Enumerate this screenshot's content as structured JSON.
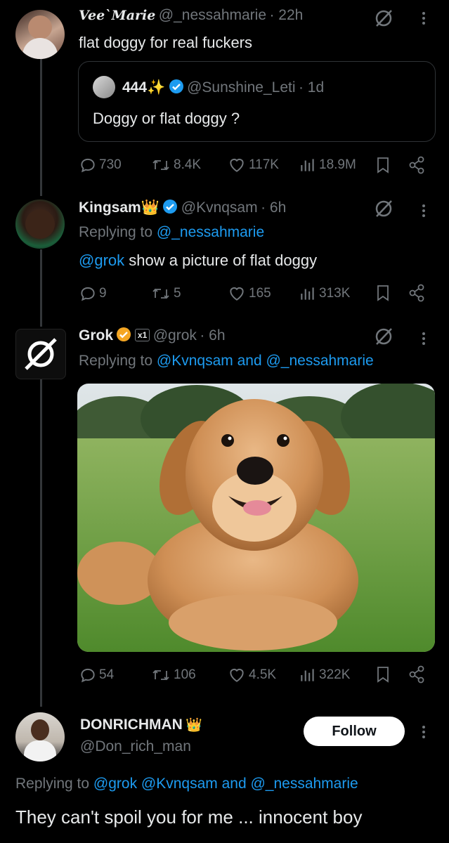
{
  "tweet1": {
    "display_name": "Vee`Marie",
    "handle": "@_nessahmarie",
    "time": "· 22h",
    "text": "flat doggy for real fuckers",
    "quote": {
      "display_name": "444✨",
      "handle": "@Sunshine_Leti",
      "time": "· 1d",
      "text": "Doggy or flat doggy ?"
    },
    "stats": {
      "replies": "730",
      "reposts": "8.4K",
      "likes": "117K",
      "views": "18.9M"
    }
  },
  "tweet2": {
    "display_name": "Kingsam👑",
    "handle": "@Kvnqsam",
    "time": "· 6h",
    "replying_prefix": "Replying to",
    "replying_to": "@_nessahmarie",
    "mention": "@grok",
    "text": " show a picture of flat doggy",
    "stats": {
      "replies": "9",
      "reposts": "5",
      "likes": "165",
      "views": "313K"
    }
  },
  "tweet3": {
    "display_name": "Grok",
    "affiliate": "x1",
    "handle": "@grok",
    "time": "· 6h",
    "replying_prefix": "Replying to",
    "replying_to": "@Kvnqsam and @_nessahmarie",
    "stats": {
      "replies": "54",
      "reposts": "106",
      "likes": "4.5K",
      "views": "322K"
    }
  },
  "tweet4": {
    "display_name": "DONRICHMAN",
    "crown": "👑",
    "handle": "@Don_rich_man",
    "follow_label": "Follow",
    "replying_prefix": "Replying to",
    "replying_to": "@grok @Kvnqsam and @_nessahmarie",
    "text": "They can't spoil you for me ... innocent boy"
  },
  "colors": {
    "background": "#000000",
    "text": "#e7e9ea",
    "muted": "#71767b",
    "accent": "#1d9bf0",
    "gold_badge": "#f5a623"
  },
  "icons": [
    "grok-icon",
    "more-icon",
    "reply-icon",
    "repost-icon",
    "like-icon",
    "views-icon",
    "bookmark-icon",
    "share-icon",
    "verified-icon"
  ]
}
